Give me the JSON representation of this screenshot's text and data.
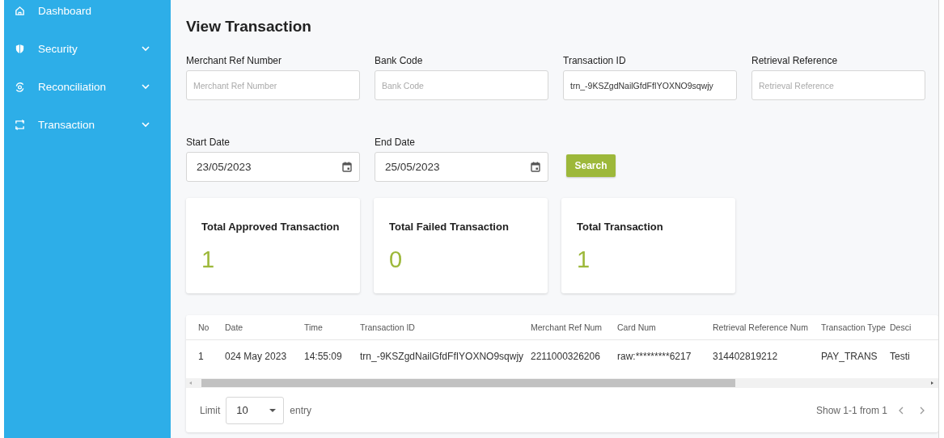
{
  "sidebar": {
    "items": [
      {
        "label": "Dashboard",
        "has_submenu": false
      },
      {
        "label": "Security",
        "has_submenu": true
      },
      {
        "label": "Reconciliation",
        "has_submenu": true
      },
      {
        "label": "Transaction",
        "has_submenu": true
      }
    ]
  },
  "page": {
    "title": "View Transaction"
  },
  "filters": [
    {
      "kind": "text",
      "label": "Merchant Ref Number",
      "placeholder": "Merchant Ref Number"
    },
    {
      "kind": "text",
      "label": "Bank Code",
      "placeholder": "Bank Code"
    },
    {
      "kind": "text",
      "label": "Transaction ID",
      "value": "trn_-9KSZgdNailGfdFfIYOXNO9sqwjy"
    },
    {
      "kind": "text",
      "label": "Retrieval Reference",
      "placeholder": "Retrieval Reference"
    },
    {
      "kind": "date",
      "label": "Start Date",
      "value": "23/05/2023"
    },
    {
      "kind": "date",
      "label": "End Date",
      "value": "25/05/2023"
    }
  ],
  "search_button": "Search",
  "stats": [
    {
      "title": "Total Approved Transaction",
      "value": "1"
    },
    {
      "title": "Total Failed Transaction",
      "value": "0"
    },
    {
      "title": "Total Transaction",
      "value": "1"
    }
  ],
  "table": {
    "columns": [
      "No",
      "Date",
      "Time",
      "Transaction ID",
      "Merchant Ref Num",
      "Card Num",
      "Retrieval Reference Num",
      "Transaction Type",
      "Desci"
    ],
    "rows": [
      [
        "1",
        "024 May 2023",
        "14:55:09",
        "trn_-9KSZgdNailGfdFfIYOXNO9sqwjy",
        "2211000326206",
        "raw:*********6217",
        "314402819212",
        "PAY_TRANS",
        "Testi"
      ]
    ]
  },
  "pagination": {
    "limit_label": "Limit",
    "limit_value": "10",
    "entry_label": "entry",
    "range": "Show 1-1 from 1"
  }
}
